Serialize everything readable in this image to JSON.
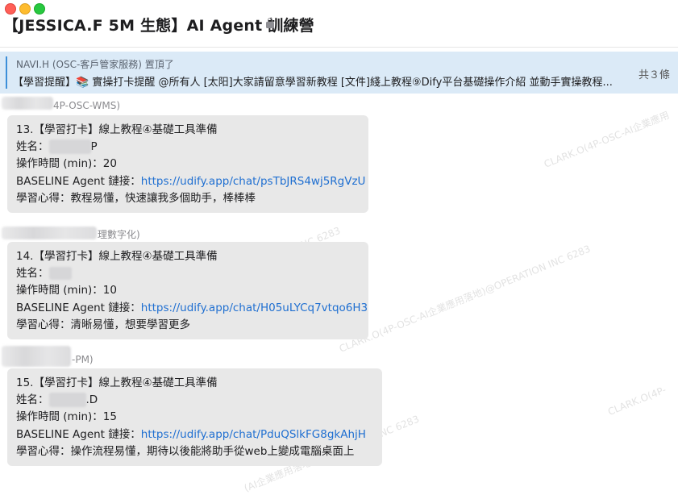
{
  "window": {
    "title": "【JESSICA.F 5M 生態】AI Agent 訓練營"
  },
  "pinned": {
    "meta": "NAVI.H (OSC-客戶管家服務) 置頂了",
    "text": "【學習提醒】📚 實操打卡提醒 @所有人 [太阳]大家請留意學習新教程 [文件]綫上教程⑨Dify平台基礎操作介紹 並動手實操教程...",
    "count": "共３條"
  },
  "messages": [
    {
      "sender_suffix": "4P-OSC-WMS)",
      "header": "13.【學習打卡】線上教程④基礎工具準備",
      "name_label": "姓名：",
      "name_tail": "P",
      "time_label": "操作時間 (min)：",
      "time_value": "20",
      "link_label": "BASELINE Agent 鏈接：",
      "link": "https://udify.app/chat/psTbJRS4wj5RgVzU",
      "note_label": "學習心得：",
      "note": "教程易懂，快速讓我多個助手，棒棒棒"
    },
    {
      "sender_suffix": "理數字化)",
      "header": "14.【學習打卡】線上教程④基礎工具準備",
      "name_label": "姓名：",
      "name_tail": "",
      "time_label": "操作時間 (min)：",
      "time_value": "10",
      "link_label": "BASELINE Agent 鏈接：",
      "link": "https://udify.app/chat/H05uLYCq7vtqo6H3",
      "note_label": "學習心得：",
      "note": "清晰易懂，想要學習更多"
    },
    {
      "sender_suffix": "-PM)",
      "header": "15.【學習打卡】線上教程④基礎工具準備",
      "name_label": "姓名：",
      "name_tail": ".D",
      "time_label": "操作時間 (min)：",
      "time_value": "15",
      "link_label": "BASELINE Agent 鏈接：",
      "link": "https://udify.app/chat/PduQSlkFG8gkAhjH",
      "note_label": "學習心得：",
      "note": "操作流程易懂，期待以後能將助手從web上變成電腦桌面上"
    }
  ],
  "watermark": {
    "text1": "CLARK.O(4P-OSC-AI企業應用",
    "text2": "落地)@OPERATION INC 6283",
    "text3": "CLARK.O(4P-OSC-AI企業應用落地)@OPERATION INC 6283",
    "text4": "CLARK.O(4P-",
    "text5": "(AI企業應用落地)@OPERATION INC 6283"
  },
  "colors": {
    "pinned_bg": "#dbeaf7",
    "bubble_bg": "#e8e8e8",
    "link": "#1f6fd1",
    "pin_accent": "#3d8fd9"
  }
}
